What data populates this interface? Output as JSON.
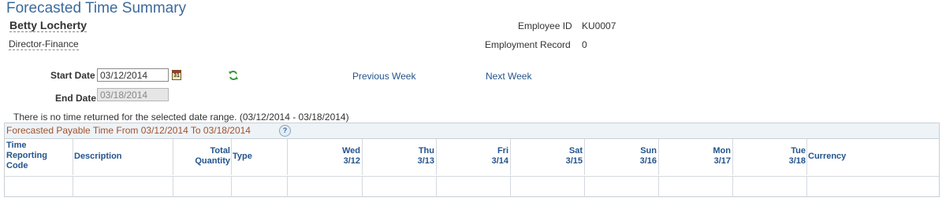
{
  "page": {
    "title": "Forecasted Time Summary"
  },
  "employee": {
    "name": "Betty Locherty",
    "job_title": "Director-Finance",
    "employee_id_label": "Employee ID",
    "employee_id": "KU0007",
    "employment_record_label": "Employment Record",
    "employment_record": "0"
  },
  "dates": {
    "start_label": "Start Date",
    "start_value": "03/12/2014",
    "end_label": "End Date",
    "end_value": "03/18/2014",
    "previous_week": "Previous Week",
    "next_week": "Next Week",
    "calendar_icon_text": "31"
  },
  "message": "There is no time returned for the selected date range. (03/12/2014 - 03/18/2014)",
  "grid": {
    "title": "Forecasted Payable Time From 03/12/2014 To 03/18/2014",
    "help_symbol": "?",
    "columns": {
      "trc": [
        "Time",
        "Reporting",
        "Code"
      ],
      "description": "Description",
      "total_quantity": [
        "Total",
        "Quantity"
      ],
      "type": "Type",
      "days": [
        {
          "day": "Wed",
          "date": "3/12"
        },
        {
          "day": "Thu",
          "date": "3/13"
        },
        {
          "day": "Fri",
          "date": "3/14"
        },
        {
          "day": "Sat",
          "date": "3/15"
        },
        {
          "day": "Sun",
          "date": "3/16"
        },
        {
          "day": "Mon",
          "date": "3/17"
        },
        {
          "day": "Tue",
          "date": "3/18"
        }
      ],
      "currency": "Currency"
    },
    "rows": []
  },
  "colors": {
    "title": "#3b6a9c",
    "link": "#24548c",
    "grid_title": "#a0522d",
    "grid_header_bg": "#eef3f7",
    "refresh_icon": "#3a9a3a"
  },
  "icons": {
    "calendar": "calendar-icon",
    "refresh": "refresh-icon",
    "help": "help-icon"
  }
}
